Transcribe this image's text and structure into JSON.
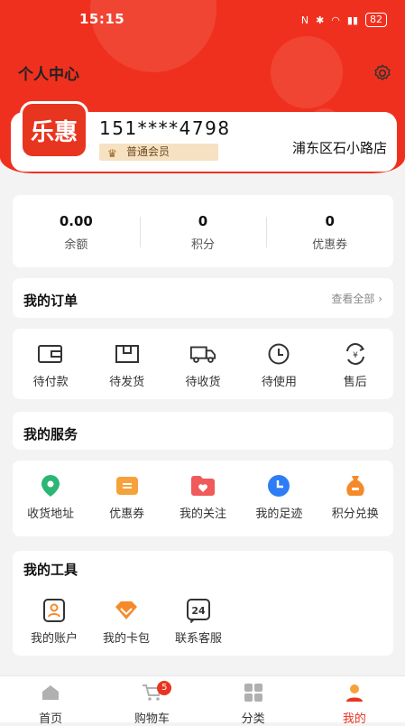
{
  "status_bar": {
    "time": "15:15",
    "battery": "82"
  },
  "header": {
    "title": "个人中心"
  },
  "profile": {
    "avatar_text": "乐惠",
    "phone": "151****4798",
    "member_level": "普通会员",
    "store": "浦东区石小路店"
  },
  "stats": [
    {
      "value": "0.00",
      "label": "余额"
    },
    {
      "value": "0",
      "label": "积分"
    },
    {
      "value": "0",
      "label": "优惠券"
    }
  ],
  "orders": {
    "title": "我的订单",
    "view_all": "查看全部",
    "items": [
      {
        "label": "待付款",
        "icon": "wallet-icon"
      },
      {
        "label": "待发货",
        "icon": "package-icon"
      },
      {
        "label": "待收货",
        "icon": "truck-icon"
      },
      {
        "label": "待使用",
        "icon": "clock-icon"
      },
      {
        "label": "售后",
        "icon": "refund-icon"
      }
    ]
  },
  "services": {
    "title": "我的服务",
    "items": [
      {
        "label": "收货地址",
        "icon": "location-icon",
        "color": "#2bb673"
      },
      {
        "label": "优惠券",
        "icon": "coupon-icon",
        "color": "#f6a23a"
      },
      {
        "label": "我的关注",
        "icon": "heart-folder-icon",
        "color": "#f05a5a"
      },
      {
        "label": "我的足迹",
        "icon": "history-icon",
        "color": "#2f7df6"
      },
      {
        "label": "积分兑换",
        "icon": "money-bag-icon",
        "color": "#f58a2a"
      }
    ]
  },
  "tools": {
    "title": "我的工具",
    "items": [
      {
        "label": "我的账户",
        "icon": "account-icon"
      },
      {
        "label": "我的卡包",
        "icon": "card-pack-icon"
      },
      {
        "label": "联系客服",
        "icon": "service-24-icon",
        "icon_text": "24"
      }
    ]
  },
  "tabbar": {
    "items": [
      {
        "label": "首页",
        "icon": "home-icon"
      },
      {
        "label": "购物车",
        "icon": "cart-icon",
        "badge": "5"
      },
      {
        "label": "分类",
        "icon": "category-icon"
      },
      {
        "label": "我的",
        "icon": "profile-icon"
      }
    ]
  },
  "colors": {
    "primary": "#f0301e",
    "member_bg": "#f6e2c2"
  }
}
